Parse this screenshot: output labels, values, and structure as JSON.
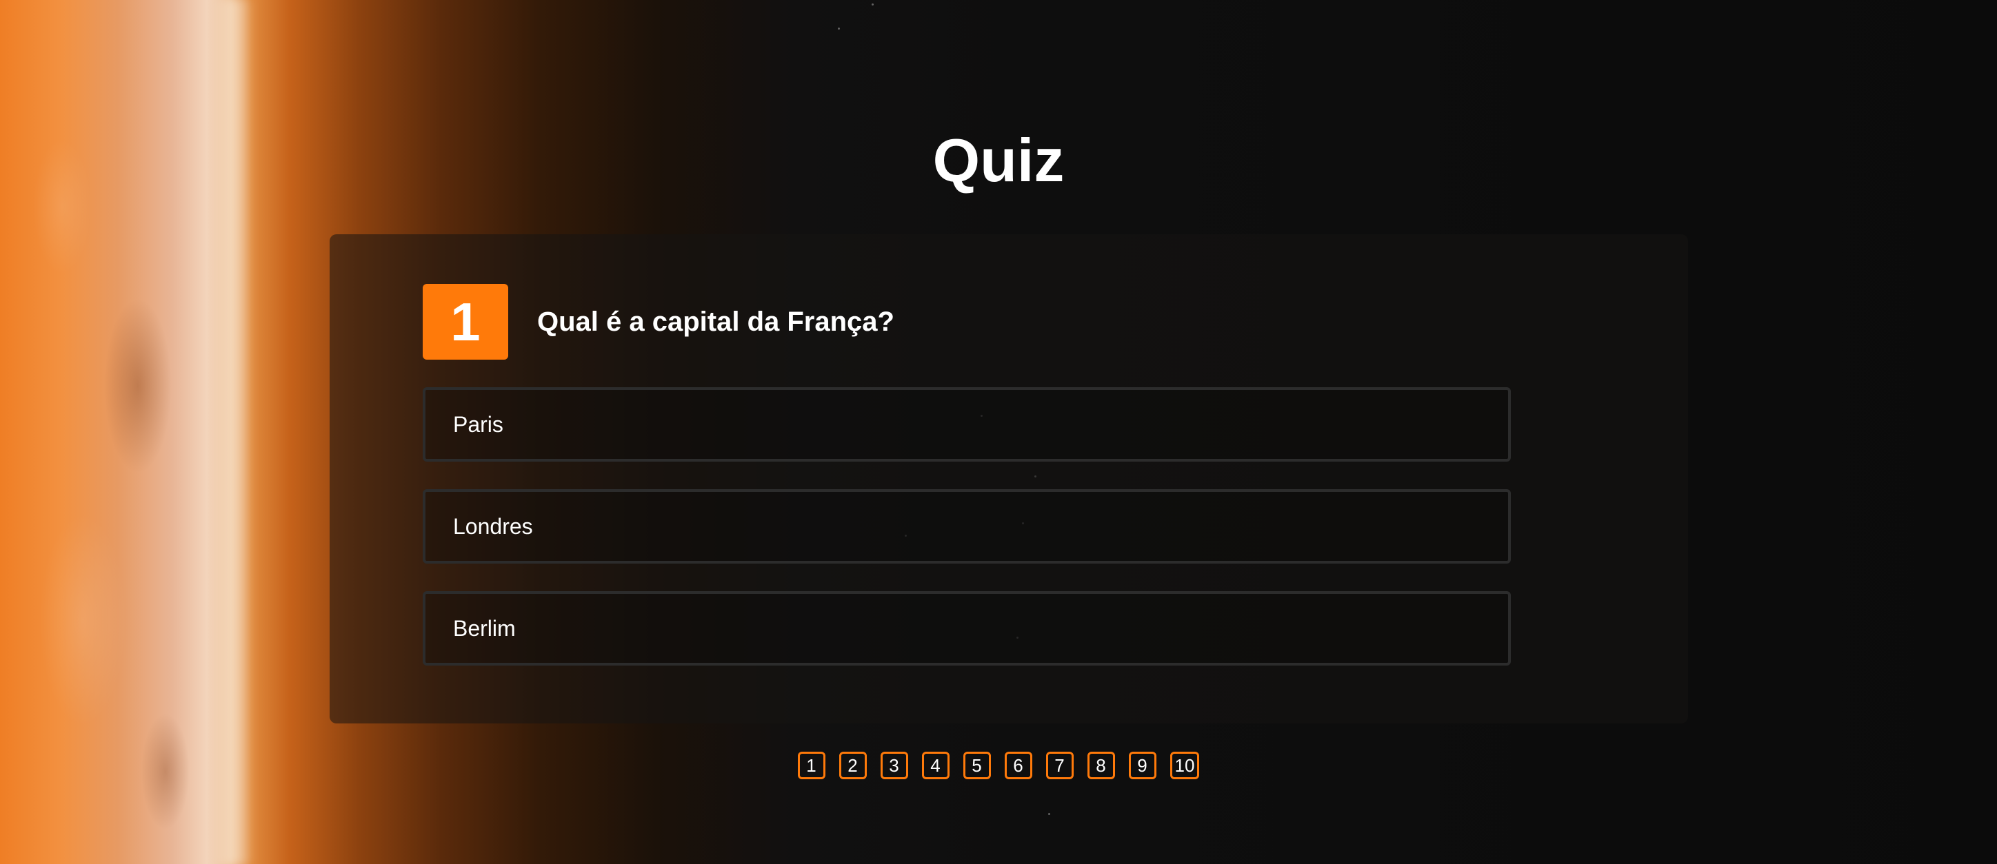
{
  "page": {
    "title": "Quiz"
  },
  "question": {
    "number": "1",
    "text": "Qual é a capital da França?",
    "options": [
      "Paris",
      "Londres",
      "Berlim"
    ]
  },
  "pagination": {
    "pages": [
      "1",
      "2",
      "3",
      "4",
      "5",
      "6",
      "7",
      "8",
      "9",
      "10"
    ],
    "current": "1"
  },
  "colors": {
    "accent": "#ff7a0a",
    "card_border": "#2c2c2c",
    "text": "#ffffff",
    "background": "#0b0b0b"
  }
}
